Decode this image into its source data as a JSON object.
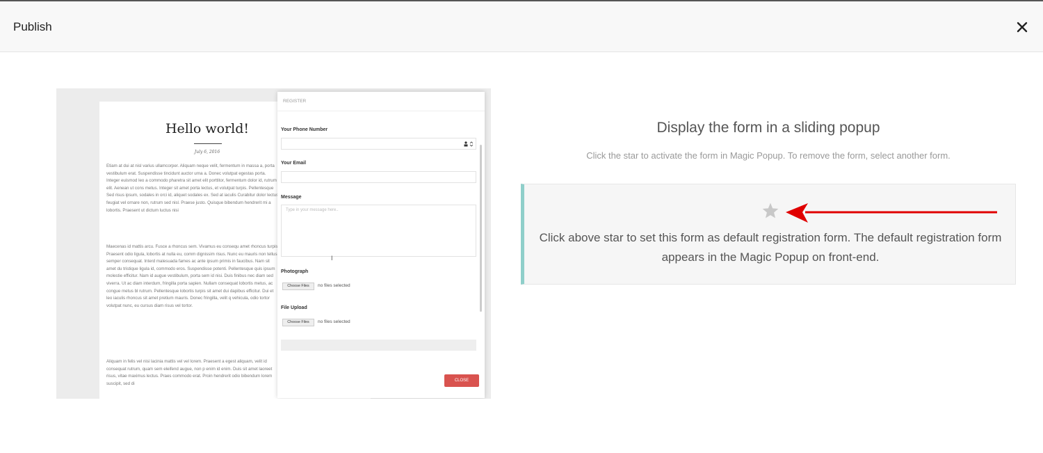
{
  "header": {
    "title": "Publish"
  },
  "preview": {
    "page": {
      "title": "Hello world!",
      "date": "July 6, 2016",
      "para1": "Etiam at dui at nisl varius ullamcorper. Aliquam neque velit, fermentum in massa a, porta vestibulum erat. Suspendisse tincidunt auctor urna a. Donec volutpat egestas porta. Integer euismod leo a commodo pharetra sit amet elit porttitor, fermentum dolor id, rutrum elit. Aenean ut cons metus. Integer sit amet porta lectus, et volutpat turpis. Pellentesque Sed risus ipsum, sodales in orci id, aliquet sodales ex. Sed at iaculis Curabitur dolor lectus, feugiat vel ornare non, rutrum sed nisl. Praese justo. Quisque bibendum hendrerit mi a lobortis. Praesent ut dictum luctus nisi",
      "para2": "Maecenas id mattis arcu. Fusce a rhoncus sem. Vivamus eu consequ amet rhoncus turpis. Praesent odio ligula, lobortis at nulla eu, comm dignissim risus. Nunc eu mauris non tellus semper consequat. Interd malesuada fames ac ante ipsum primis in faucibus. Nam sit amet du tristique ligula id, commodo eros. Suspendisse potenti. Pellentesque quis ipsum molestie efficitur. Nam id augue vestibulum, porta sem id nisi. Duis finibus nec diam sed viverra. Ut ac diam interdum, fringilla porta sapien. Nullam consequat lobortis metus, ac congue metus bl rutrum. Pellentesque lobortis turpis sit amet dui dapibus efficitur. Dui et leo iaculis rhoncus sit amet pretium mauris. Donec fringilla, velit q vehicula, odio tortor volutpat nunc, eu cursus diam risus vel tortor.",
      "para3": "Aliquam in felis vel nisi lacinia mattis vel vel lorem. Praesent a egest aliquam, velit id consequat rutrum, quam sem eleifend augue, non p enim id enim. Duis sit amet laoreet risus, vitae maximus lectus. Praes commodo erat. Proin hendrerit odio bibendum lorem suscipit, sed di"
    },
    "modal": {
      "heading": "REGISTER",
      "phone_label": "Your Phone Number",
      "email_label": "Your Email",
      "message_label": "Message",
      "message_placeholder": "Type in your message here..",
      "photo_label": "Photograph",
      "upload_label": "File Upload",
      "choose_files": "Choose Files",
      "no_files": "no files selected",
      "close_label": "CLOSE"
    }
  },
  "right": {
    "title": "Display the form in a sliding popup",
    "subtitle": "Click the star to activate the form in Magic Popup. To remove the form, select another form.",
    "card_text": "Click above star to set this form as default registration form. The default registration form appears in the Magic Popup on front-end."
  },
  "icons": {
    "close": "close-icon",
    "star": "star-icon",
    "arrow": "arrow-left-icon",
    "cursor": "text-cursor-icon"
  },
  "colors": {
    "accent_border": "#8fcfca",
    "arrow": "#e00000",
    "star": "#c8c8c8",
    "modal_close": "#d9534f"
  }
}
